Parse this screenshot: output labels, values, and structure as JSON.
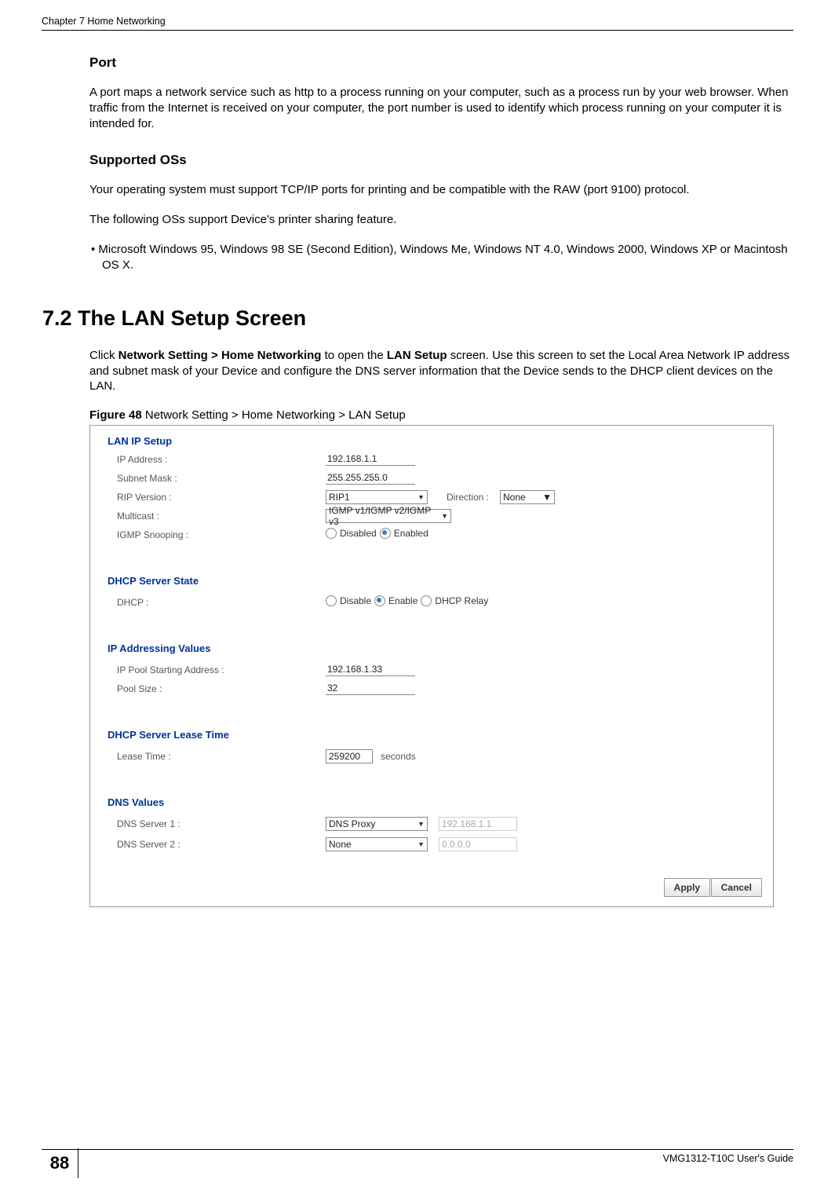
{
  "header": {
    "chapter": "Chapter 7 Home Networking"
  },
  "section_port": {
    "title": "Port",
    "para": "A port maps a network service such as http to a process running on your computer, such as a process run by your web browser. When traffic from the Internet is received on your computer, the port number is used to identify which process running on your computer it is intended for."
  },
  "section_os": {
    "title": "Supported OSs",
    "para1": "Your operating system must support TCP/IP ports for printing and be compatible with the RAW (port 9100) protocol.",
    "para2": "The following OSs support Device's printer sharing feature.",
    "bullet": "• Microsoft Windows 95, Windows 98 SE (Second Edition), Windows Me, Windows NT 4.0, Windows 2000, Windows XP or Macintosh OS X."
  },
  "section_lan": {
    "title": "7.2  The LAN Setup Screen",
    "para_pre": "Click ",
    "para_bold1": "Network Setting > Home Networking",
    "para_mid1": " to open the ",
    "para_bold2": "LAN Setup",
    "para_post": " screen. Use this screen to set the Local Area Network IP address and subnet mask of your Device and configure the DNS server information that the Device sends to the DHCP client devices on the LAN."
  },
  "figure": {
    "label": "Figure 48",
    "caption": "   Network Setting > Home Networking > LAN Setup"
  },
  "screenshot": {
    "sec1": "LAN IP Setup",
    "ip_addr_label": "IP Address :",
    "ip_addr_value": "192.168.1.1",
    "subnet_label": "Subnet Mask :",
    "subnet_value": "255.255.255.0",
    "rip_label": "RIP Version :",
    "rip_value": "RIP1",
    "direction_label": "Direction :",
    "direction_value": "None",
    "multicast_label": "Multicast :",
    "multicast_value": "IGMP v1/IGMP v2/IGMP v3",
    "igmp_snoop_label": "IGMP Snooping :",
    "igmp_disabled": "Disabled",
    "igmp_enabled": "Enabled",
    "sec2": "DHCP Server State",
    "dhcp_label": "DHCP :",
    "dhcp_disable": "Disable",
    "dhcp_enable": "Enable",
    "dhcp_relay": "DHCP Relay",
    "sec3": "IP Addressing Values",
    "pool_start_label": "IP Pool Starting Address :",
    "pool_start_value": "192.168.1.33",
    "pool_size_label": "Pool Size :",
    "pool_size_value": "32",
    "sec4": "DHCP Server Lease Time",
    "lease_label": "Lease Time :",
    "lease_value": "259200",
    "lease_unit": "seconds",
    "sec5": "DNS Values",
    "dns1_label": "DNS Server 1 :",
    "dns1_sel": "DNS Proxy",
    "dns1_ip": "192.168.1.1",
    "dns2_label": "DNS Server 2 :",
    "dns2_sel": "None",
    "dns2_ip": "0.0.0.0",
    "apply": "Apply",
    "cancel": "Cancel"
  },
  "footer": {
    "page": "88",
    "guide": "VMG1312-T10C User's Guide"
  }
}
